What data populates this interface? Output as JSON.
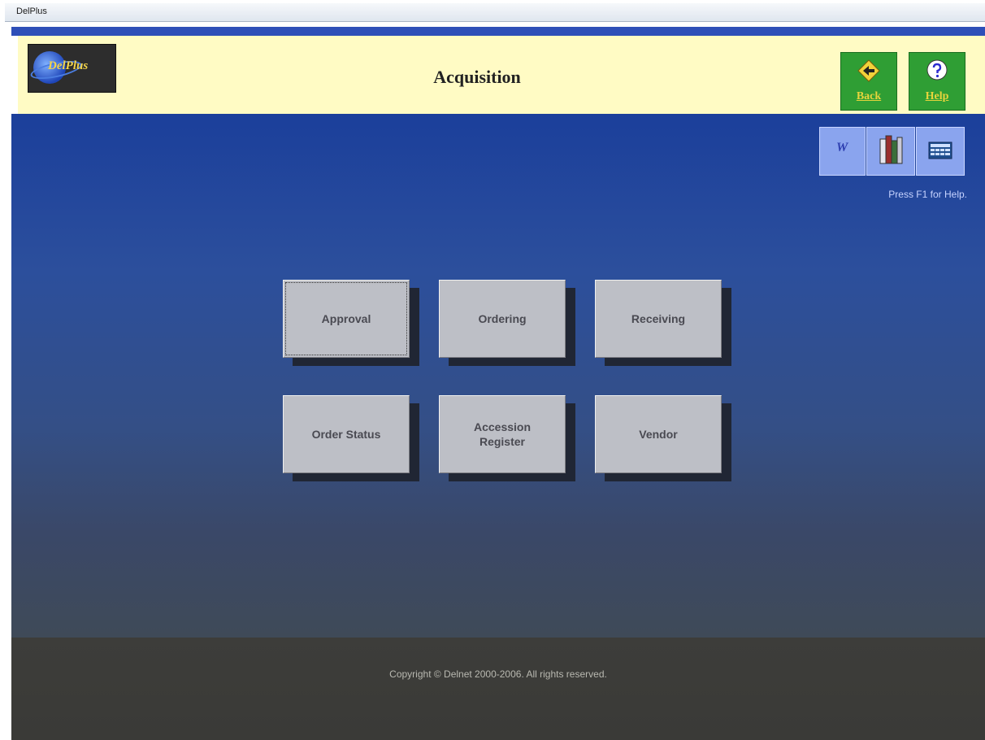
{
  "window": {
    "title": "DelPlus"
  },
  "header": {
    "logo_text": "DelPlus",
    "page_title": "Acquisition",
    "back_label": "Back",
    "help_label": "Help"
  },
  "toolbar": {
    "word_glyph": "W"
  },
  "help_hint": "Press F1 for Help.",
  "menu": {
    "approval": "Approval",
    "ordering": "Ordering",
    "receiving": "Receiving",
    "order_status": "Order Status",
    "accession_register": "Accession\nRegister",
    "vendor": "Vendor"
  },
  "footer": {
    "copyright": "Copyright © Delnet 2000-2006. All rights reserved."
  },
  "colors": {
    "header_bg": "#fffbc4",
    "accent_blue": "#2e4fb8",
    "button_green": "#2f9e34",
    "button_label": "#e6d43c",
    "menu_button": "#bdbfc6"
  },
  "icons": {
    "back": "back-arrow-icon",
    "help": "question-mark-icon",
    "word": "word-w-icon",
    "books": "books-icon",
    "calculator": "calculator-icon"
  }
}
